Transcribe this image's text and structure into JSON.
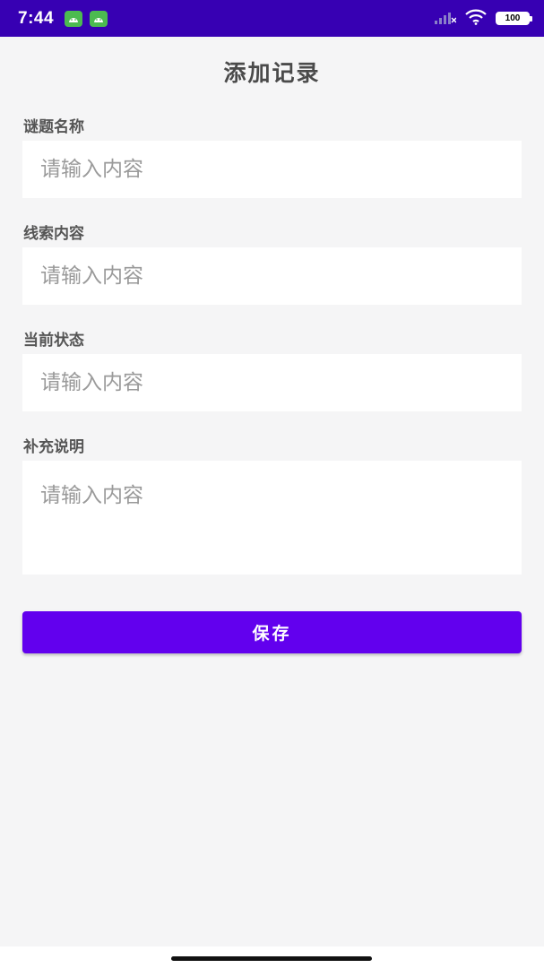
{
  "status_bar": {
    "time": "7:44",
    "battery": "100",
    "notification_icons": [
      "android-app-icon",
      "android-app-icon"
    ],
    "icons": [
      "signal-icon",
      "wifi-icon",
      "battery-icon"
    ],
    "background_color": "#3700b3"
  },
  "page": {
    "title": "添加记录"
  },
  "form": {
    "fields": [
      {
        "label": "谜题名称",
        "placeholder": "请输入内容",
        "value": ""
      },
      {
        "label": "线索内容",
        "placeholder": "请输入内容",
        "value": ""
      },
      {
        "label": "当前状态",
        "placeholder": "请输入内容",
        "value": ""
      },
      {
        "label": "补充说明",
        "placeholder": "请输入内容",
        "value": ""
      }
    ],
    "save_label": "保存",
    "accent_color": "#6200ee"
  }
}
